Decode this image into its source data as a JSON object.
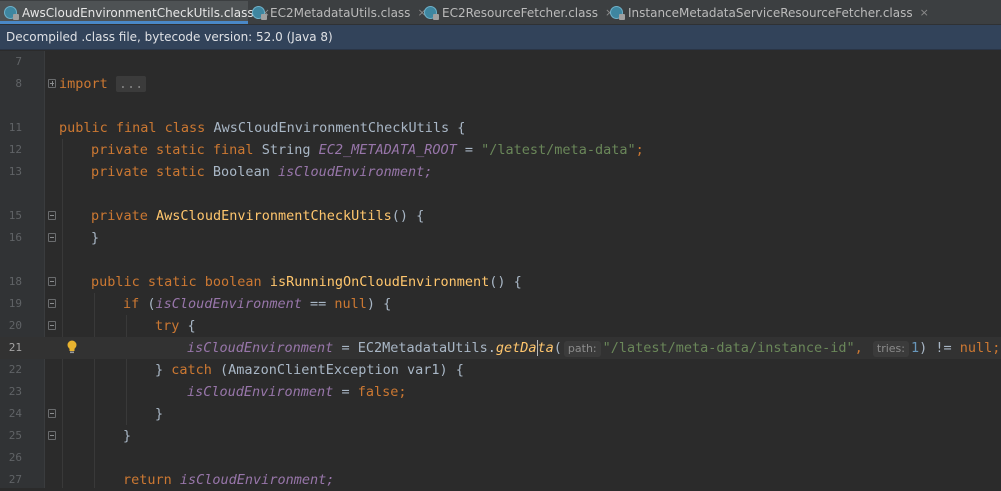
{
  "tabs": [
    {
      "label": "AwsCloudEnvironmentCheckUtils.class",
      "active": true
    },
    {
      "label": "EC2MetadataUtils.class",
      "active": false
    },
    {
      "label": "EC2ResourceFetcher.class",
      "active": false
    },
    {
      "label": "InstanceMetadataServiceResourceFetcher.class",
      "active": false
    }
  ],
  "tab_close_glyph": "×",
  "banner": {
    "text": "Decompiled .class file, bytecode version: 52.0 (Java 8)"
  },
  "editor": {
    "current_line": 21,
    "line_numbers": [
      "7",
      "8",
      "",
      "11",
      "12",
      "13",
      "",
      "15",
      "16",
      "",
      "18",
      "19",
      "20",
      "21",
      "22",
      "23",
      "24",
      "25",
      "26",
      "27"
    ],
    "tokens": {
      "import_kw": "import",
      "import_fold": "...",
      "l11_kw": "public final class",
      "l11_name": "AwsCloudEnvironmentCheckUtils",
      "l11_brace": " {",
      "l12_kw": "private static final",
      "l12_type": " String ",
      "l12_field": "EC2_METADATA_ROOT",
      "l12_eq": " = ",
      "l12_str": "\"/latest/meta-data\"",
      "l12_semi": ";",
      "l13_kw": "private static",
      "l13_type": " Boolean ",
      "l13_field": "isCloudEnvironment;",
      "l15_kw": "private",
      "l15_name": "AwsCloudEnvironmentCheckUtils",
      "l15_rest": "() {",
      "l16": "}",
      "l18_kw": "public static boolean",
      "l18_name": "isRunningOnCloudEnvironment",
      "l18_rest": "() {",
      "l19_kw": "if",
      "l19_open": " (",
      "l19_field": "isCloudEnvironment",
      "l19_op": " == ",
      "l19_null": "null",
      "l19_rest": ") {",
      "l20_kw": "try",
      "l20_rest": " {",
      "l21_field": "isCloudEnvironment",
      "l21_eq": " = EC2MetadataUtils.",
      "l21_call_a": "getDa",
      "l21_call_b": "ta",
      "l21_paren": "(",
      "l21_hint_path": "path:",
      "l21_str": "\"/latest/meta-data/instance-id\"",
      "l21_comma": ",",
      "l21_hint_tries": "tries:",
      "l21_num": "1",
      "l21_rest": ") != ",
      "l21_null": "null",
      "l21_semi": ";",
      "l22_close": "} ",
      "l22_kw": "catch",
      "l22_rest": " (AmazonClientException var1) {",
      "l23_field": "isCloudEnvironment",
      "l23_eq": " = ",
      "l23_false": "false",
      "l23_semi": ";",
      "l24": "}",
      "l25": "}",
      "l27_kw": "return",
      "l27_field": " isCloudEnvironment;"
    }
  },
  "colors": {
    "keyword": "#cc7832",
    "function": "#ffc66d",
    "field": "#9876aa",
    "string": "#6a8759",
    "number": "#6897bb",
    "text": "#a9b7c6",
    "background": "#2b2b2b"
  },
  "icons": [
    "class-file-icon",
    "fold-toggle-icon",
    "lightbulb-intention-icon"
  ]
}
